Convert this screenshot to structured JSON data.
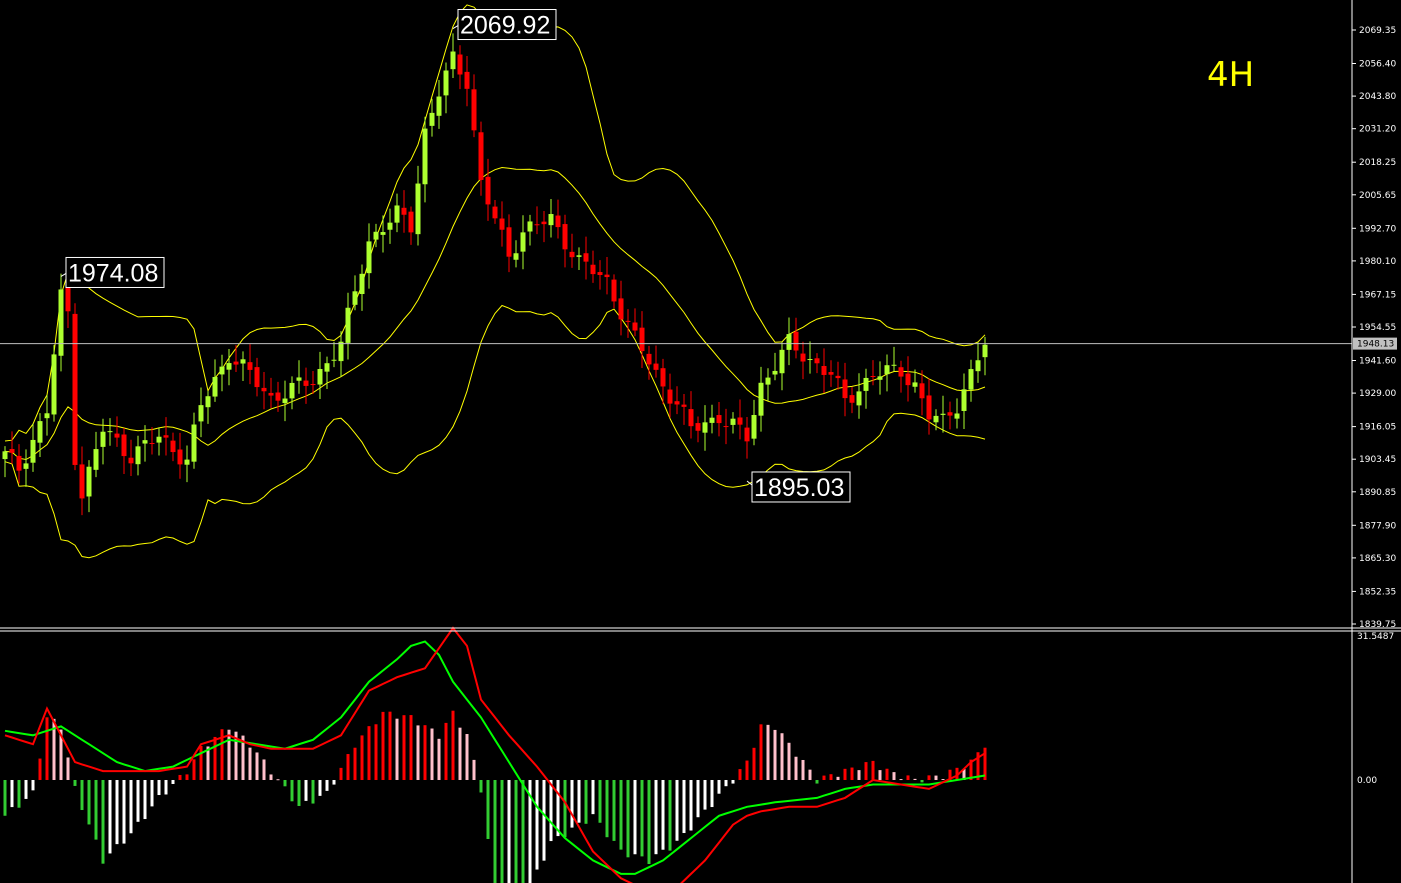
{
  "timeframe": "4H",
  "colors": {
    "background": "#000000",
    "bull_candle": "#adff2f",
    "bear_candle": "#ff0000",
    "band": "#ffff00",
    "timeframe_label": "#ffff00",
    "price_line": "#c0c0c0",
    "macd_line": "#ff0000",
    "signal_line": "#00ff00",
    "hist_pos_rising": "#ff0000",
    "hist_pos_falling": "#ffc0cb",
    "hist_neg_falling": "#32cd32",
    "hist_neg_rising": "#ffffff"
  },
  "price_axis": {
    "ticks": [
      "2069.35",
      "2056.40",
      "2043.80",
      "2031.20",
      "2018.25",
      "2005.65",
      "1992.70",
      "1980.10",
      "1967.15",
      "1954.55",
      "1941.60",
      "1929.00",
      "1916.05",
      "1903.45",
      "1890.85",
      "1877.90",
      "1865.30",
      "1852.35",
      "1839.75"
    ],
    "current_price": "1948.13"
  },
  "annotations": [
    {
      "text": "1974.08",
      "price": 1974.08,
      "bar": 8
    },
    {
      "text": "2069.92",
      "price": 2069.92,
      "bar": 64
    },
    {
      "text": "1895.03",
      "price": 1895.03,
      "bar": 106
    }
  ],
  "macd_axis": {
    "top": "31.5487",
    "zero": "0.00"
  },
  "chart_data": [
    {
      "type": "candlestick",
      "title": "",
      "ylim": [
        1839.75,
        2075
      ],
      "indicators": [
        "bollinger_bands",
        "price_line"
      ],
      "ohlc_generated_from": {
        "anchors": [
          [
            0,
            1905
          ],
          [
            2,
            1900
          ],
          [
            6,
            1922
          ],
          [
            8,
            1966
          ],
          [
            9,
            1960
          ],
          [
            10,
            1905
          ],
          [
            11,
            1890
          ],
          [
            14,
            1915
          ],
          [
            18,
            1905
          ],
          [
            22,
            1912
          ],
          [
            26,
            1903
          ],
          [
            28,
            1924
          ],
          [
            32,
            1944
          ],
          [
            35,
            1936
          ],
          [
            38,
            1927
          ],
          [
            44,
            1934
          ],
          [
            48,
            1948
          ],
          [
            52,
            1988
          ],
          [
            56,
            1998
          ],
          [
            58,
            1994
          ],
          [
            60,
            2030
          ],
          [
            62,
            2045
          ],
          [
            64,
            2058
          ],
          [
            66,
            2050
          ],
          [
            68,
            2010
          ],
          [
            72,
            1982
          ],
          [
            74,
            1992
          ],
          [
            78,
            1996
          ],
          [
            82,
            1980
          ],
          [
            86,
            1972
          ],
          [
            90,
            1950
          ],
          [
            94,
            1932
          ],
          [
            96,
            1925
          ],
          [
            98,
            1915
          ],
          [
            102,
            1920
          ],
          [
            106,
            1912
          ],
          [
            108,
            1932
          ],
          [
            110,
            1940
          ],
          [
            112,
            1948
          ],
          [
            114,
            1944
          ],
          [
            118,
            1936
          ],
          [
            120,
            1926
          ],
          [
            124,
            1936
          ],
          [
            128,
            1938
          ],
          [
            130,
            1932
          ],
          [
            132,
            1920
          ],
          [
            134,
            1918
          ],
          [
            136,
            1925
          ],
          [
            138,
            1936
          ],
          [
            140,
            1948
          ]
        ],
        "note": "bar index → close"
      },
      "bars": 141
    },
    {
      "type": "bar",
      "title": "",
      "ylim": [
        -31,
        31.5487
      ],
      "series": [
        {
          "name": "",
          "kind": "histogram",
          "anchors": [
            [
              0,
              -8
            ],
            [
              4,
              -3
            ],
            [
              6,
              14
            ],
            [
              8,
              12
            ],
            [
              10,
              -2
            ],
            [
              14,
              -18
            ],
            [
              18,
              -12
            ],
            [
              22,
              -4
            ],
            [
              26,
              2
            ],
            [
              28,
              7
            ],
            [
              32,
              12
            ],
            [
              35,
              8
            ],
            [
              38,
              2
            ],
            [
              42,
              -6
            ],
            [
              46,
              -3
            ],
            [
              50,
              8
            ],
            [
              54,
              15
            ],
            [
              58,
              14
            ],
            [
              62,
              10
            ],
            [
              64,
              15
            ],
            [
              66,
              10
            ],
            [
              68,
              -2
            ],
            [
              70,
              -25
            ],
            [
              74,
              -27
            ],
            [
              78,
              -14
            ],
            [
              84,
              -8
            ],
            [
              88,
              -16
            ],
            [
              92,
              -18
            ],
            [
              96,
              -14
            ],
            [
              100,
              -7
            ],
            [
              104,
              0
            ],
            [
              106,
              4
            ],
            [
              108,
              12
            ],
            [
              110,
              12
            ],
            [
              112,
              8
            ],
            [
              114,
              4
            ],
            [
              116,
              0
            ],
            [
              120,
              2
            ],
            [
              124,
              4
            ],
            [
              126,
              2
            ],
            [
              130,
              0
            ],
            [
              134,
              1
            ],
            [
              138,
              4
            ],
            [
              140,
              8
            ]
          ]
        },
        {
          "name": "",
          "kind": "macd_line",
          "anchors": [
            [
              0,
              10
            ],
            [
              4,
              8
            ],
            [
              6,
              16
            ],
            [
              8,
              10
            ],
            [
              10,
              4
            ],
            [
              14,
              2
            ],
            [
              18,
              2
            ],
            [
              22,
              2
            ],
            [
              26,
              3
            ],
            [
              28,
              8
            ],
            [
              32,
              10
            ],
            [
              35,
              8
            ],
            [
              38,
              7
            ],
            [
              44,
              7
            ],
            [
              48,
              10
            ],
            [
              52,
              20
            ],
            [
              56,
              23
            ],
            [
              60,
              25
            ],
            [
              64,
              34
            ],
            [
              66,
              30
            ],
            [
              68,
              18
            ],
            [
              72,
              10
            ],
            [
              76,
              3
            ],
            [
              80,
              -5
            ],
            [
              84,
              -16
            ],
            [
              88,
              -22
            ],
            [
              92,
              -25
            ],
            [
              96,
              -24
            ],
            [
              100,
              -18
            ],
            [
              104,
              -10
            ],
            [
              106,
              -8
            ],
            [
              108,
              -7
            ],
            [
              112,
              -6
            ],
            [
              116,
              -6
            ],
            [
              120,
              -4
            ],
            [
              124,
              0
            ],
            [
              128,
              -1
            ],
            [
              132,
              -2
            ],
            [
              136,
              1
            ],
            [
              138,
              4
            ],
            [
              140,
              6
            ]
          ]
        },
        {
          "name": "",
          "kind": "signal_line",
          "anchors": [
            [
              0,
              11
            ],
            [
              4,
              10
            ],
            [
              8,
              12
            ],
            [
              12,
              8
            ],
            [
              16,
              4
            ],
            [
              20,
              2
            ],
            [
              24,
              3
            ],
            [
              28,
              6
            ],
            [
              32,
              9
            ],
            [
              36,
              8
            ],
            [
              40,
              7
            ],
            [
              44,
              9
            ],
            [
              48,
              14
            ],
            [
              52,
              22
            ],
            [
              56,
              27
            ],
            [
              58,
              30
            ],
            [
              60,
              31
            ],
            [
              62,
              28
            ],
            [
              64,
              22
            ],
            [
              68,
              14
            ],
            [
              72,
              4
            ],
            [
              76,
              -6
            ],
            [
              80,
              -13
            ],
            [
              84,
              -18
            ],
            [
              88,
              -21
            ],
            [
              90,
              -21
            ],
            [
              94,
              -18
            ],
            [
              98,
              -13
            ],
            [
              102,
              -8
            ],
            [
              106,
              -6
            ],
            [
              110,
              -5
            ],
            [
              116,
              -4
            ],
            [
              120,
              -2
            ],
            [
              124,
              -1
            ],
            [
              128,
              -1
            ],
            [
              132,
              -1
            ],
            [
              136,
              0
            ],
            [
              140,
              1
            ]
          ]
        }
      ]
    }
  ]
}
